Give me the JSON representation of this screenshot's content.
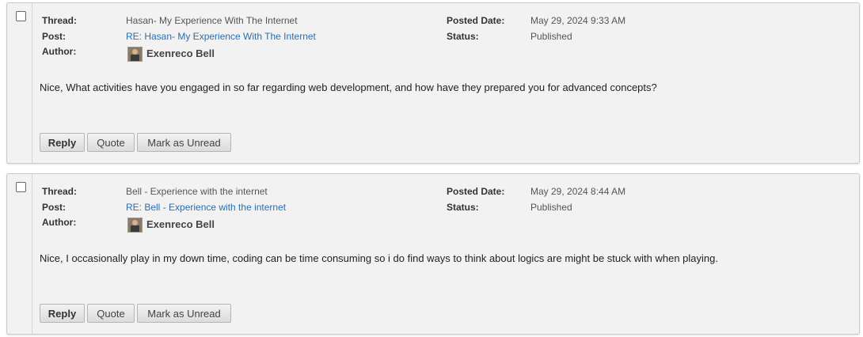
{
  "labels": {
    "thread": "Thread:",
    "post": "Post:",
    "author": "Author:",
    "posted_date": "Posted Date:",
    "status": "Status:"
  },
  "buttons": {
    "reply": "Reply",
    "quote": "Quote",
    "mark_unread": "Mark as Unread"
  },
  "posts": [
    {
      "thread": "Hasan- My Experience With The Internet",
      "post_link": "RE: Hasan- My Experience With The Internet",
      "author": "Exenreco Bell",
      "posted_date": "May 29, 2024 9:33 AM",
      "status": "Published",
      "message": "Nice, What activities have you engaged in so far regarding web development, and how have they prepared you for advanced concepts?"
    },
    {
      "thread": "Bell - Experience with the internet",
      "post_link": "RE: Bell - Experience with the internet",
      "author": "Exenreco Bell",
      "posted_date": "May 29, 2024 8:44 AM",
      "status": "Published",
      "message": "Nice, I occasionally play in my down time, coding can be time consuming so i do find ways to think about logics are might be stuck with when playing."
    }
  ]
}
